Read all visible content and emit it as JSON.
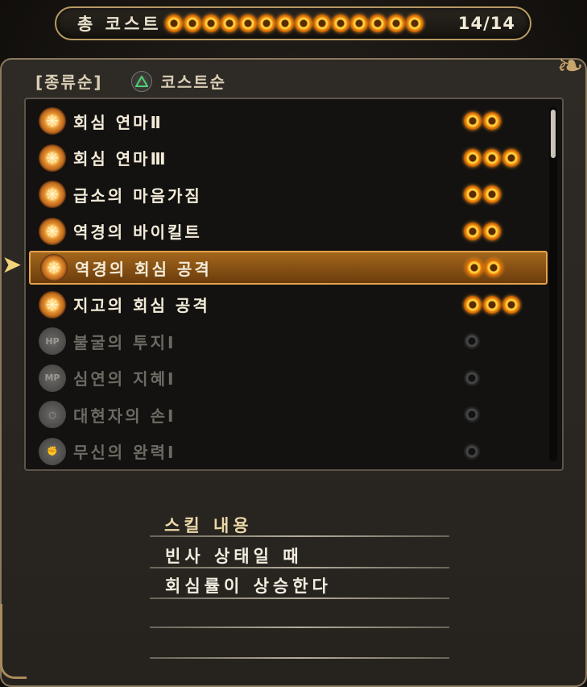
{
  "header": {
    "label": "총 코스트",
    "count": "14/14",
    "orb_count": 14
  },
  "sort": {
    "kind_label": "[종류순]",
    "button_icon": "triangle-button-icon",
    "cost_label": "코스트순"
  },
  "skills": [
    {
      "name": "회심 연마Ⅱ",
      "cost": 2,
      "locked": false,
      "icon": "crit-skill-icon"
    },
    {
      "name": "회심 연마Ⅲ",
      "cost": 3,
      "locked": false,
      "icon": "crit-skill-icon"
    },
    {
      "name": "급소의 마음가짐",
      "cost": 2,
      "locked": false,
      "icon": "crit-skill-icon"
    },
    {
      "name": "역경의 바이킬트",
      "cost": 2,
      "locked": false,
      "icon": "crit-skill-icon"
    },
    {
      "name": "역경의 회심 공격",
      "cost": 2,
      "locked": false,
      "selected": true,
      "icon": "crit-skill-icon"
    },
    {
      "name": "지고의 회심 공격",
      "cost": 3,
      "locked": false,
      "icon": "crit-skill-icon"
    },
    {
      "name": "불굴의 투지Ⅰ",
      "cost": 1,
      "locked": true,
      "icon": "hp-skill-icon",
      "icon_text": "HP"
    },
    {
      "name": "심연의 지혜Ⅰ",
      "cost": 1,
      "locked": true,
      "icon": "mp-skill-icon",
      "icon_text": "MP"
    },
    {
      "name": "대현자의 손Ⅰ",
      "cost": 1,
      "locked": true,
      "icon": "hand-skill-icon",
      "icon_text": "○"
    },
    {
      "name": "무신의 완력Ⅰ",
      "cost": 1,
      "locked": true,
      "icon": "arm-skill-icon",
      "icon_text": "✊"
    }
  ],
  "description": {
    "title": "스킬 내용",
    "lines": [
      "빈사 상태일 때",
      "회심률이 상승한다"
    ]
  },
  "colors": {
    "accent_gold": "#c7a56a",
    "selection": "#a3661c",
    "orb": "#f08a10"
  }
}
